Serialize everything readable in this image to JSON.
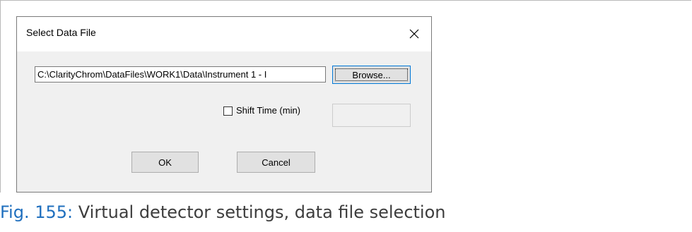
{
  "dialog": {
    "title": "Select Data File",
    "close_glyph": "✕",
    "file_path": "C:\\ClarityChrom\\DataFiles\\WORK1\\Data\\Instrument 1 - I",
    "browse_label": "Browse...",
    "shift_time": {
      "label": "Shift Time (min)",
      "checked": false,
      "value": ""
    },
    "ok_label": "OK",
    "cancel_label": "Cancel"
  },
  "caption": {
    "number": "Fig. 155:",
    "text": "Virtual detector settings, data file selection",
    "number_color": "#1f6fbe"
  },
  "icons": {
    "close": "close-icon"
  }
}
